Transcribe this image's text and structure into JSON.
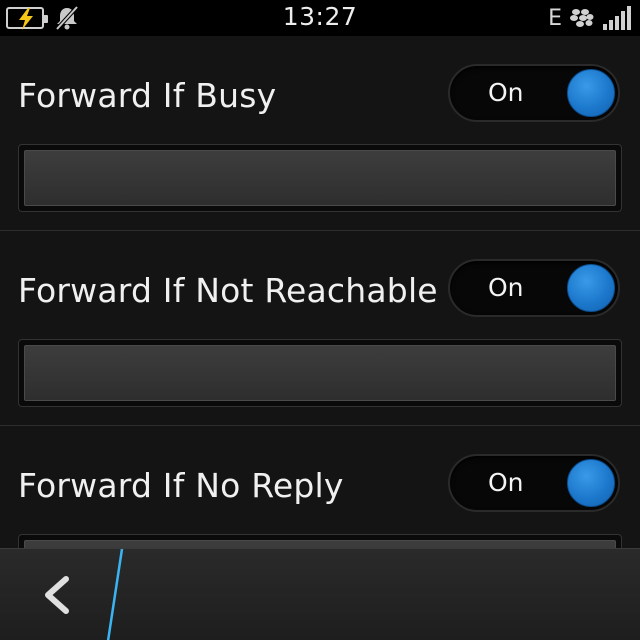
{
  "status_bar": {
    "time": "13:27",
    "network_type": "E",
    "icons": [
      "battery-charging-icon",
      "notifications-muted-icon",
      "blackberry-messenger-icon",
      "signal-strength-icon"
    ]
  },
  "settings": [
    {
      "title": "Forward If Busy",
      "toggle_label": "On",
      "field_value": ""
    },
    {
      "title": "Forward If Not Reachable",
      "toggle_label": "On",
      "field_value": ""
    },
    {
      "title": "Forward If No Reply",
      "toggle_label": "On",
      "field_value": ""
    }
  ],
  "action_bar": {
    "icons": [
      "back-arrow-icon"
    ]
  },
  "colors": {
    "accent": "#1c78cc",
    "background": "#141414",
    "status_bar": "#000000",
    "divider_accent": "#3ab4f2"
  }
}
